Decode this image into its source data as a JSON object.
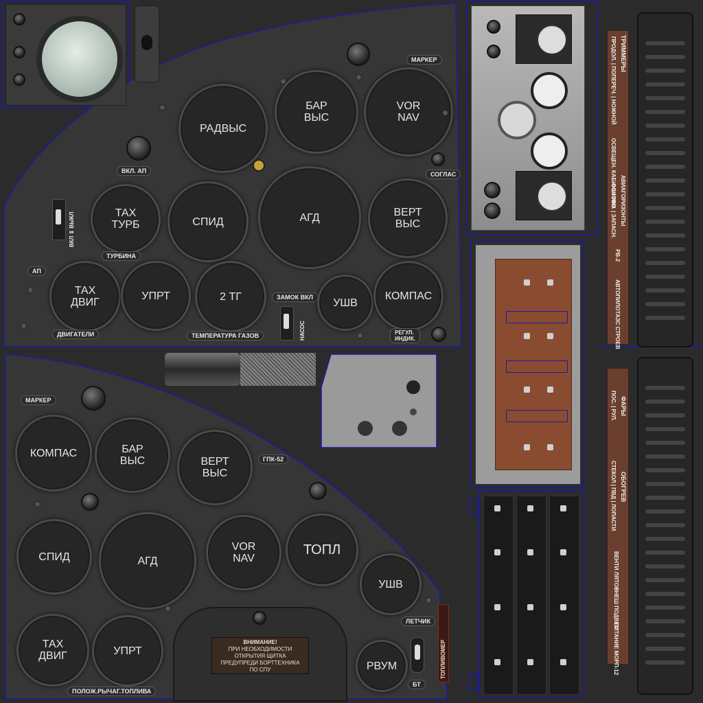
{
  "upper_panel": {
    "gauges": {
      "radvys": "РАДВЫС",
      "barvys": "БАР\nВЫС",
      "vornav": "VOR\nNAV",
      "takh_turb": "ТАХ\nТУРБ",
      "spid": "СПИД",
      "agd": "АГД",
      "vert_vys": "ВЕРТ\nВЫС",
      "takh_dvig": "ТАХ\nДВИГ",
      "uprt": "УПРТ",
      "two_tg": "2 ТГ",
      "ushv": "УШВ",
      "kompas": "КОМПАС"
    },
    "labels": {
      "marker": "МАРКЕР",
      "vkl_ap": "ВКЛ. АП",
      "soglas": "СОГЛАС",
      "vkl_vykl": "ВКЛ ⇕ ВЫКЛ",
      "turbina": "ТУРБИНА",
      "ap": "АП",
      "dvigateli": "ДВИГАТЕЛИ",
      "temp_gazov": "ТЕМПЕРАТУРА ГАЗОВ",
      "zamok_vkl": "ЗАМОК ВКЛ",
      "nasos": "НАСОС",
      "regul_indik": "РЕГУЛ.\nИНДИК."
    }
  },
  "lower_panel": {
    "gauges": {
      "kompas": "КОМПАС",
      "barvys": "БАР\nВЫС",
      "vert_vys": "ВЕРТ\nВЫС",
      "spid": "СПИД",
      "agd": "АГД",
      "vornav": "VOR\nNAV",
      "topl": "ТОПЛ",
      "ushv": "УШВ",
      "takh_dvig": "ТАХ\nДВИГ",
      "uprt": "УПРТ",
      "rvum": "РВУМ"
    },
    "labels": {
      "marker": "МАРКЕР",
      "gpk52": "ГПК-52",
      "letchik": "ЛЕТЧИК",
      "toplivomer": "ТОПЛИВОМЕР",
      "bt": "БТ",
      "poloj": "ПОЛОЖ.РЫЧАГ.ТОПЛИВА"
    },
    "warning": {
      "title": "ВНИМАНИЕ!",
      "lines": "ПРИ НЕОБХОДИМОСТИ\nОТКРЫТИЯ ЩИТКА\nПРЕДУПРЕДИ БОРТТЕХНИКА\nПО СПУ"
    }
  },
  "right_strip_top": {
    "header": "ТРИММЕРЫ",
    "items": [
      "ПРОДОЛ. | ПОПЕРЕЧ. | НОЖНОЙ",
      "ОСВЕЩЕН. КАБИНЫ УФО",
      "АВИАГОРИЗОНТЫ",
      "ОСНОВН. | ЗАПАСН.",
      "РВ-2",
      "АВТОПИЛОТ",
      "АЗС СТРОЕВ"
    ]
  },
  "right_strip_bottom": {
    "header": "ФАРЫ",
    "items": [
      "ПОС. | РУЛ.",
      "ОБОГРЕВ",
      "СТЕКОЛ | ПВД | ЛОПАСТИ",
      "ВЕНТИ ЛЯТОР",
      "ВНЕШ ПОДВЕС",
      "ПИТАНИЕ МОРП-12"
    ]
  },
  "colors": {
    "background": "#2b2b2b",
    "panel": "#383838",
    "outline": "#1a1aa8",
    "copper": "#8a4c30",
    "label_strip": "#6b3f2e",
    "gray_box": "#9a9a9a"
  }
}
